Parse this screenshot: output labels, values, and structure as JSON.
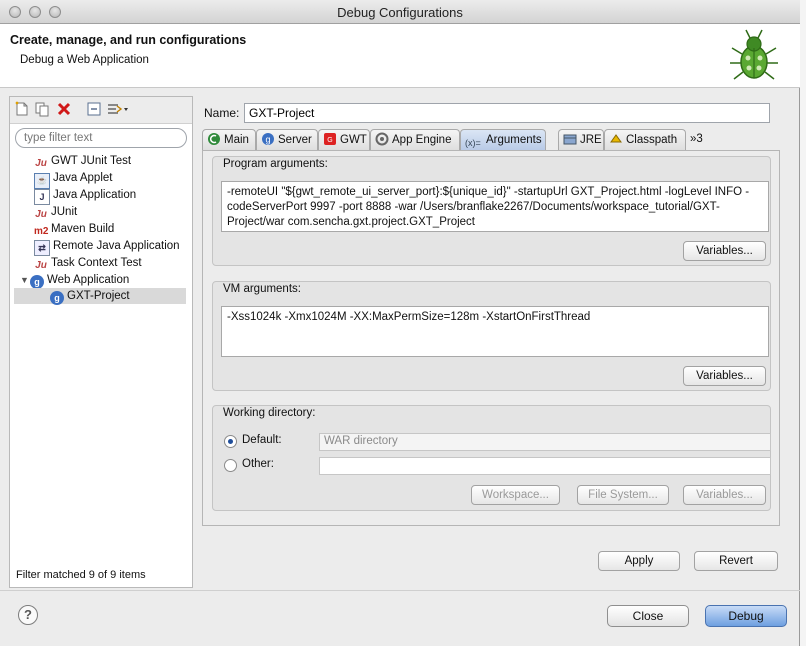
{
  "window": {
    "title": "Debug Configurations"
  },
  "header": {
    "title": "Create, manage, and run configurations",
    "subtitle": "Debug a Web Application",
    "icon": "bug-icon"
  },
  "left_panel": {
    "toolbar_icons": [
      "new-config-icon",
      "duplicate-icon",
      "delete-icon",
      "collapse-all-icon",
      "filter-icon"
    ],
    "filter_placeholder": "type filter text",
    "tree": [
      {
        "label": "GWT JUnit Test",
        "icon": "junit-gwt-icon",
        "level": 1
      },
      {
        "label": "Java Applet",
        "icon": "java-applet-icon",
        "level": 1
      },
      {
        "label": "Java Application",
        "icon": "java-app-icon",
        "level": 1
      },
      {
        "label": "JUnit",
        "icon": "junit-icon",
        "level": 1
      },
      {
        "label": "Maven Build",
        "icon": "maven-icon",
        "level": 1
      },
      {
        "label": "Remote Java Application",
        "icon": "remote-java-icon",
        "level": 1
      },
      {
        "label": "Task Context Test",
        "icon": "task-context-icon",
        "level": 1
      },
      {
        "label": "Web Application",
        "icon": "web-app-icon",
        "level": 1,
        "expanded": true
      },
      {
        "label": "GXT-Project",
        "icon": "web-app-icon",
        "level": 2,
        "selected": true
      }
    ],
    "status": "Filter matched 9 of 9 items"
  },
  "config": {
    "name_label": "Name:",
    "name_value": "GXT-Project",
    "tabs": [
      {
        "label": "Main",
        "icon": "main-tab-icon"
      },
      {
        "label": "Server",
        "icon": "server-tab-icon"
      },
      {
        "label": "GWT",
        "icon": "gwt-tab-icon"
      },
      {
        "label": "App Engine",
        "icon": "app-engine-tab-icon"
      },
      {
        "label": "Arguments",
        "icon": "arguments-tab-icon",
        "active": true
      },
      {
        "label": "JRE",
        "icon": "jre-tab-icon"
      },
      {
        "label": "Classpath",
        "icon": "classpath-tab-icon"
      },
      {
        "label": "»3",
        "icon": ""
      }
    ],
    "program_args": {
      "label": "Program arguments:",
      "value": "-remoteUI \"${gwt_remote_ui_server_port}:${unique_id}\" -startupUrl GXT_Project.html -logLevel INFO -codeServerPort 9997 -port 8888 -war /Users/branflake2267/Documents/workspace_tutorial/GXT-Project/war com.sencha.gxt.project.GXT_Project",
      "variables_button": "Variables..."
    },
    "vm_args": {
      "label": "VM arguments:",
      "value": "-Xss1024k -Xmx1024M -XX:MaxPermSize=128m -XstartOnFirstThread",
      "variables_button": "Variables..."
    },
    "working_dir": {
      "label": "Working directory:",
      "default_label": "Default:",
      "default_value": "WAR directory",
      "default_selected": true,
      "other_label": "Other:",
      "other_value": "",
      "workspace_button": "Workspace...",
      "filesystem_button": "File System...",
      "variables_button": "Variables..."
    },
    "apply_button": "Apply",
    "revert_button": "Revert"
  },
  "footer": {
    "help_label": "?",
    "close_button": "Close",
    "debug_button": "Debug"
  },
  "colors": {
    "window_bg": "#ececec",
    "selection_bg": "#d9d9d9",
    "active_tab": "#b7c9e6",
    "default_button": "#6e9fe0"
  }
}
